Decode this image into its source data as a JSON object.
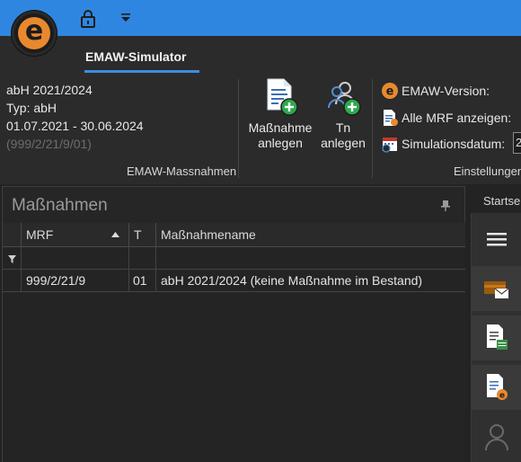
{
  "app": {
    "logo_letter": "e",
    "accent": "#2f86e0",
    "brand": "#e8892f"
  },
  "quick_access": {
    "lock_icon": "lock-icon",
    "dropdown_icon": "caret-down-icon"
  },
  "ribbon": {
    "active_tab": "EMAW-Simulator",
    "info": {
      "line1": "abH 2021/2024",
      "line2": "Typ: abH",
      "line3": "01.07.2021 - 30.06.2024",
      "line4": "(999/2/21/9/01)"
    },
    "buttons": {
      "massnahme_line1": "Maßnahme",
      "massnahme_line2": "anlegen",
      "tn_line1": "Tn",
      "tn_line2": "anlegen"
    },
    "group_massnahmen": "EMAW-Massnahmen",
    "settings": {
      "version_label": "EMAW-Version:",
      "mrf_label": "Alle MRF anzeigen:",
      "simdate_label": "Simulationsdatum:",
      "simdate_value": "2"
    },
    "group_einstellungen": "Einstellungen"
  },
  "panel": {
    "title": "Maßnahmen",
    "columns": {
      "mrf": "MRF",
      "t": "T",
      "name": "Maßnahmename"
    },
    "rows": [
      {
        "mrf": "999/2/21/9",
        "t": "01",
        "name": "abH 2021/2024 (keine Maßnahme im Bestand)"
      }
    ]
  },
  "right": {
    "tab_label": "Startse",
    "side_icons": [
      "menu-icon",
      "mail-folder-icon",
      "document-table-icon",
      "document-e-icon",
      "user-icon"
    ]
  }
}
